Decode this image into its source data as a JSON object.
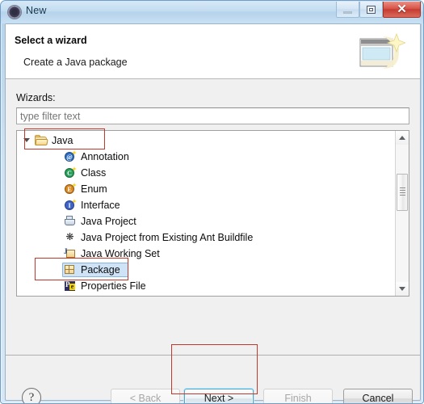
{
  "window": {
    "title": "New",
    "icon": "eclipse-new-icon",
    "controls": {
      "minimize": "Minimize",
      "maximize": "Maximize",
      "close": "✕"
    }
  },
  "header": {
    "title": "Select a wizard",
    "subtitle": "Create a Java package",
    "banner_icon": "wizard-window-sparkle-icon"
  },
  "body": {
    "wizards_label": "Wizards:",
    "filter": {
      "value": "",
      "placeholder": "type filter text"
    },
    "tree": {
      "root": {
        "label": "Java",
        "icon": "folder-open-icon",
        "expanded": true
      },
      "items": [
        {
          "label": "Annotation",
          "icon": "java-annotation-icon",
          "selected": false
        },
        {
          "label": "Class",
          "icon": "java-class-icon",
          "selected": false
        },
        {
          "label": "Enum",
          "icon": "java-enum-icon",
          "selected": false
        },
        {
          "label": "Interface",
          "icon": "java-interface-icon",
          "selected": false
        },
        {
          "label": "Java Project",
          "icon": "java-project-icon",
          "selected": false
        },
        {
          "label": "Java Project from Existing Ant Buildfile",
          "icon": "ant-buildfile-icon",
          "selected": false
        },
        {
          "label": "Java Working Set",
          "icon": "java-working-set-icon",
          "selected": false
        },
        {
          "label": "Package",
          "icon": "java-package-icon",
          "selected": true
        },
        {
          "label": "Properties File",
          "icon": "properties-file-icon",
          "selected": false
        }
      ],
      "scrollbar": {
        "up_arrow": "▲",
        "down_arrow": "▼"
      }
    }
  },
  "footer": {
    "help_label": "?",
    "buttons": [
      {
        "label": "< Back",
        "enabled": false,
        "default": false
      },
      {
        "label": "Next >",
        "enabled": true,
        "default": true
      },
      {
        "label": "Finish",
        "enabled": false,
        "default": false
      },
      {
        "label": "Cancel",
        "enabled": true,
        "default": false
      }
    ]
  },
  "annotations": {
    "color": "#c0392b",
    "boxes": [
      "java-tree-node",
      "package-tree-item",
      "next-button"
    ]
  },
  "colors": {
    "titlebar": "#c3dcf0",
    "close_button": "#c63c31",
    "selection": "#cfe3f7",
    "selection_border": "#88b4e0",
    "annotation": "#c0392b",
    "dialog_background": "#f0f0f0"
  }
}
